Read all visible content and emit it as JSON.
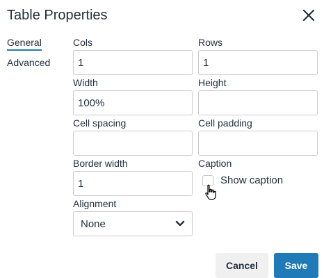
{
  "dialog": {
    "title": "Table Properties",
    "close_icon": "close-icon"
  },
  "tabs": [
    {
      "label": "General",
      "active": true
    },
    {
      "label": "Advanced",
      "active": false
    }
  ],
  "fields": {
    "cols": {
      "label": "Cols",
      "value": "1"
    },
    "rows": {
      "label": "Rows",
      "value": "1"
    },
    "width": {
      "label": "Width",
      "value": "100%"
    },
    "height": {
      "label": "Height",
      "value": ""
    },
    "cell_spacing": {
      "label": "Cell spacing",
      "value": ""
    },
    "cell_padding": {
      "label": "Cell padding",
      "value": ""
    },
    "border_width": {
      "label": "Border width",
      "value": "1"
    },
    "caption": {
      "label": "Caption",
      "checkbox_label": "Show caption",
      "checked": false
    },
    "alignment": {
      "label": "Alignment",
      "value": "None"
    }
  },
  "buttons": {
    "cancel": "Cancel",
    "save": "Save"
  },
  "colors": {
    "primary": "#207ab7",
    "text": "#222f3e",
    "border": "#cccccc"
  }
}
